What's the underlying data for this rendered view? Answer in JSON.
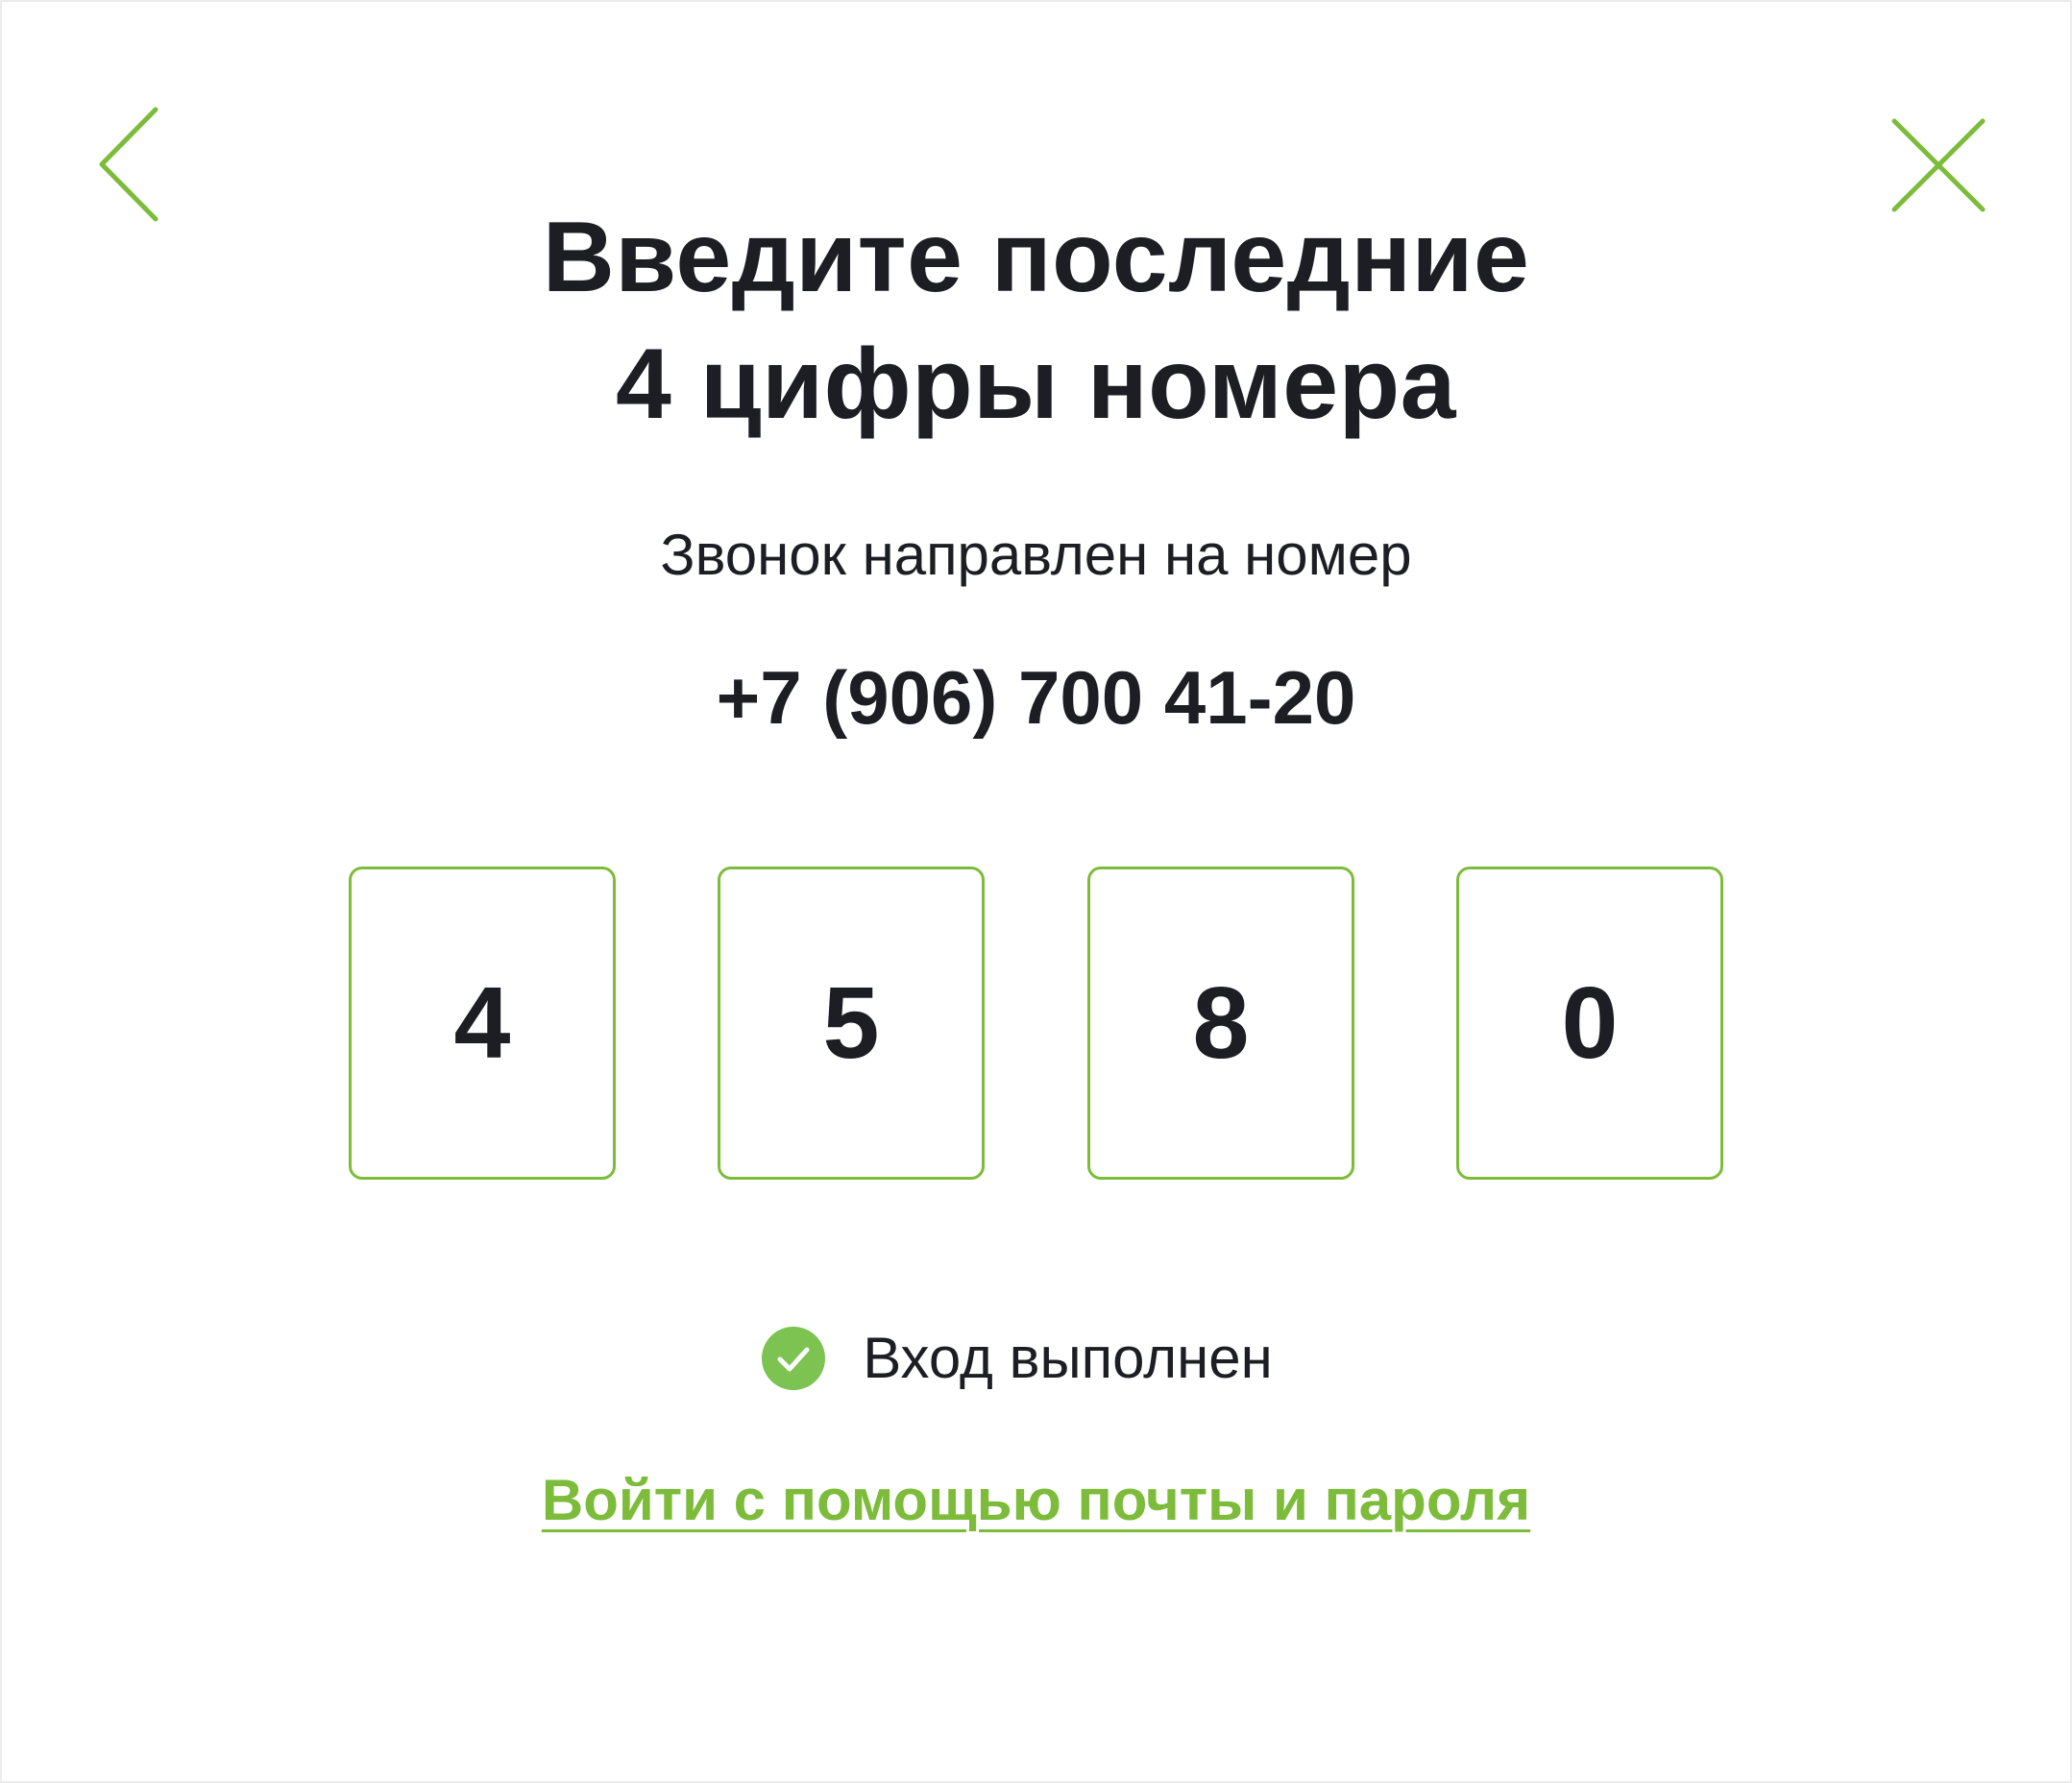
{
  "header": {
    "back_icon": "chevron-left-icon",
    "close_icon": "close-icon",
    "title_line1": "Введите последние",
    "title_line2": "4 цифры номера"
  },
  "info": {
    "subtitle": "Звонок направлен на номер",
    "phone": "+7 (906) 700 41-20"
  },
  "code": {
    "digits": [
      "4",
      "5",
      "8",
      "0"
    ]
  },
  "status": {
    "icon": "check-circle-icon",
    "text": "Вход выполнен"
  },
  "alt_login": {
    "label": "Войти с помощью почты и пароля"
  },
  "colors": {
    "accent": "#7cbc3a",
    "success": "#7cc352",
    "text": "#1c1e23"
  }
}
